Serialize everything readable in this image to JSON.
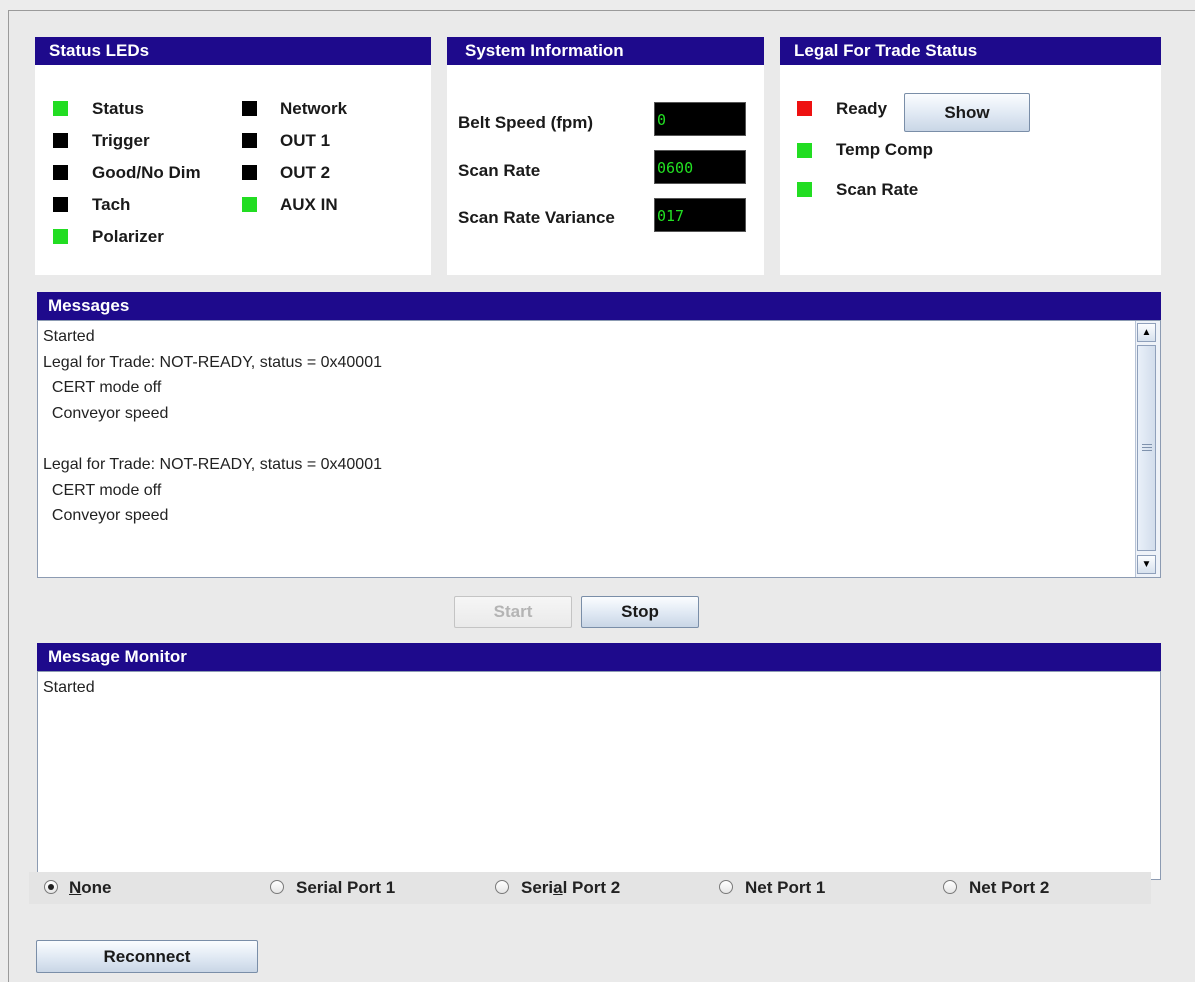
{
  "status_leds": {
    "title": "Status LEDs",
    "left": [
      {
        "label": "Status",
        "color": "#22dd22"
      },
      {
        "label": "Trigger",
        "color": "#000000"
      },
      {
        "label": "Good/No Dim",
        "color": "#000000"
      },
      {
        "label": "Tach",
        "color": "#000000"
      },
      {
        "label": "Polarizer",
        "color": "#22dd22"
      }
    ],
    "right": [
      {
        "label": "Network",
        "color": "#000000"
      },
      {
        "label": "OUT 1",
        "color": "#000000"
      },
      {
        "label": "OUT 2",
        "color": "#000000"
      },
      {
        "label": "AUX IN",
        "color": "#22dd22"
      }
    ]
  },
  "system_information": {
    "title": "System Information",
    "fields": [
      {
        "label": "Belt Speed (fpm)",
        "value": "0"
      },
      {
        "label": "Scan Rate",
        "value": "0600"
      },
      {
        "label": "Scan Rate Variance",
        "value": "017"
      }
    ]
  },
  "legal_for_trade": {
    "title": "Legal For Trade Status",
    "items": [
      {
        "label": "Ready",
        "color": "#ee1111"
      },
      {
        "label": "Temp Comp",
        "color": "#22dd22"
      },
      {
        "label": "Scan Rate",
        "color": "#22dd22"
      }
    ],
    "show_button": "Show"
  },
  "messages": {
    "title": "Messages",
    "lines": [
      "Started",
      "Legal for Trade: NOT-READY, status = 0x40001",
      "  CERT mode off",
      "  Conveyor speed",
      "",
      "Legal for Trade: NOT-READY, status = 0x40001",
      "  CERT mode off",
      "  Conveyor speed"
    ],
    "start_button": "Start",
    "stop_button": "Stop"
  },
  "message_monitor": {
    "title": "Message Monitor",
    "lines": [
      "Started"
    ],
    "radios": [
      {
        "pre": "",
        "u": "N",
        "post": "one",
        "checked": true
      },
      {
        "pre": "Serial Port 1",
        "u": "",
        "post": "",
        "checked": false
      },
      {
        "pre": "Seri",
        "u": "a",
        "post": "l Port 2",
        "checked": false
      },
      {
        "pre": "Net Port 1",
        "u": "",
        "post": "",
        "checked": false
      },
      {
        "pre": "Net Port 2",
        "u": "",
        "post": "",
        "checked": false
      }
    ],
    "reconnect_button": "Reconnect"
  }
}
